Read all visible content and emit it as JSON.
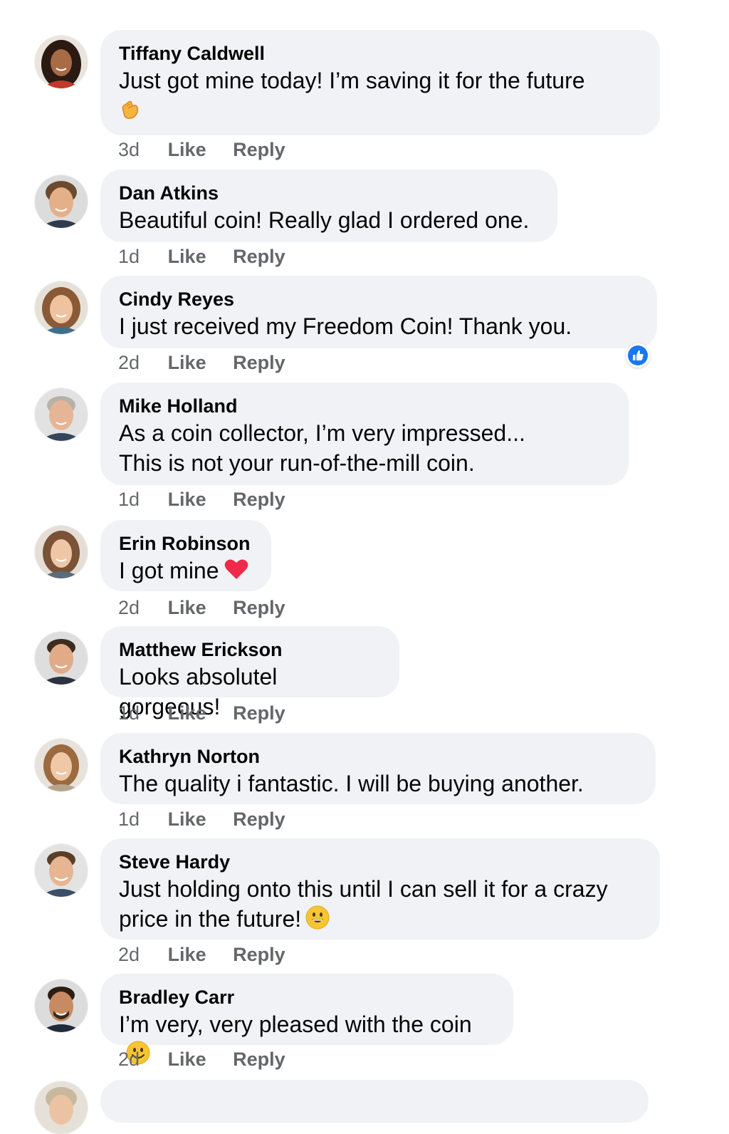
{
  "comments": [
    {
      "name": "Tiffany Caldwell",
      "lines": [
        "Just got mine  today! I’m saving it for the future"
      ],
      "emoji": "clapping-hand-icon",
      "time": "3d",
      "like": "Like",
      "reply": "Reply"
    },
    {
      "name": "Dan Atkins",
      "lines": [
        "Beautiful coin! Really glad I ordered one."
      ],
      "time": "1d",
      "like": "Like",
      "reply": "Reply"
    },
    {
      "name": "Cindy Reyes",
      "lines": [
        "I just received my Freedom Coin! Thank you."
      ],
      "reaction": "thumbs-up-icon",
      "time": "2d",
      "like": "Like",
      "reply": "Reply"
    },
    {
      "name": "Mike Holland",
      "lines": [
        "As a coin collector, I’m very impressed...",
        "This is not your run-of-the-mill coin."
      ],
      "time": "1d",
      "like": "Like",
      "reply": "Reply"
    },
    {
      "name": "Erin Robinson",
      "lines": [
        "I got mine"
      ],
      "emoji": "red-heart-icon",
      "time": "2d",
      "like": "Like",
      "reply": "Reply"
    },
    {
      "name": "Matthew Erickson",
      "lines": [
        "Looks absolutel gorgeous!"
      ],
      "time": "1d",
      "like": "Like",
      "reply": "Reply"
    },
    {
      "name": "Kathryn Norton",
      "lines": [
        "The quality i fantastic. I will be buying another."
      ],
      "time": "1d",
      "like": "Like",
      "reply": "Reply"
    },
    {
      "name": "Steve Hardy",
      "lines": [
        "Just holding onto this until I can sell it for a crazy",
        "price in the future!"
      ],
      "emoji": "grinning-face-icon",
      "time": "2d",
      "like": "Like",
      "reply": "Reply"
    },
    {
      "name": "Bradley Carr",
      "lines": [
        "I’m very, very pleased with the coin"
      ],
      "emoji": "smiling-face-icon",
      "time": "2d",
      "like": "Like",
      "reply": "Reply"
    }
  ],
  "colors": {
    "bubble": "#f0f2f5",
    "meta_text": "#65676b",
    "like_blue": "#1877f2",
    "heart_red": "#f02849"
  }
}
